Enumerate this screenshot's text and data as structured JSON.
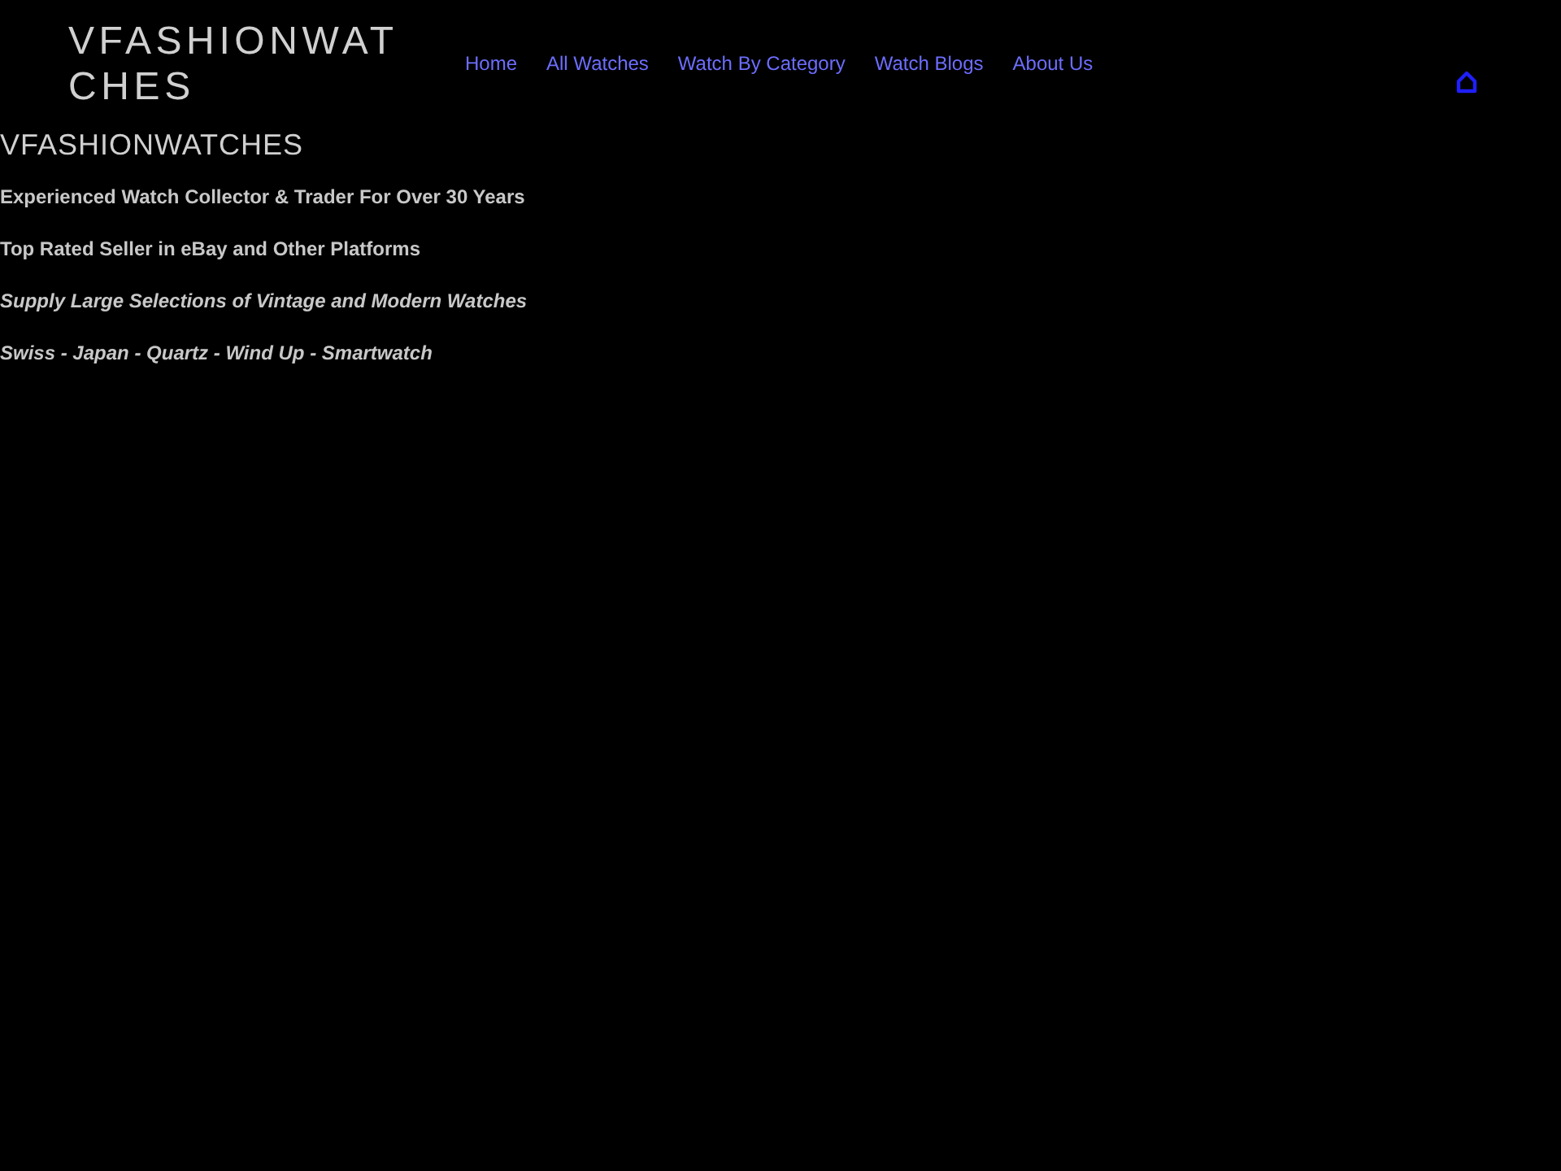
{
  "header": {
    "logo": "VFASHIONWATCHES",
    "nav": [
      "Home",
      "All Watches",
      "Watch By Category",
      "Watch Blogs",
      "About Us"
    ]
  },
  "intro": {
    "title": "VFASHIONWATCHES",
    "lines": [
      {
        "kind": "plain",
        "text": "Experienced Watch Collector & Trader For Over 30 Years"
      },
      {
        "kind": "plain",
        "text": "Top Rated Seller in eBay and Other Platforms"
      },
      {
        "kind": "emphasis",
        "text": "Supply Large Selections of Vintage and Modern Watches"
      },
      {
        "kind": "emphasis",
        "text": "Swiss - Japan - Quartz - Wind Up - Smartwatch"
      }
    ]
  }
}
